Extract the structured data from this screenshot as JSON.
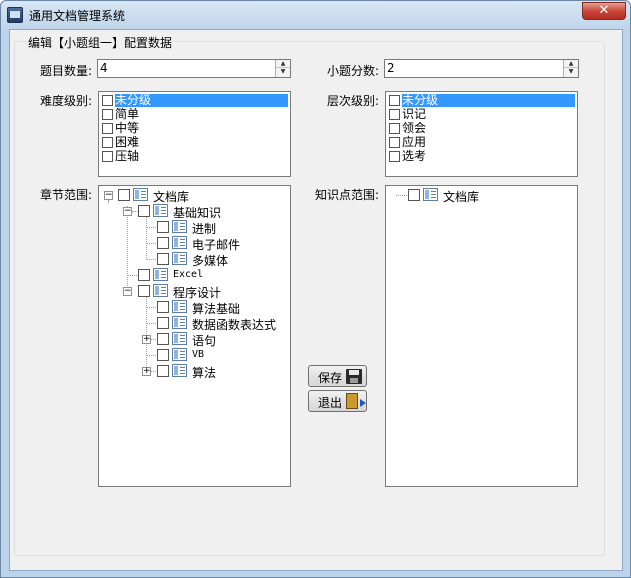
{
  "window": {
    "title": "通用文档管理系统",
    "close_glyph": "✕"
  },
  "form": {
    "group_label": "编辑【小题组一】配置数据",
    "question_count": {
      "label": "题目数量:",
      "value": "4"
    },
    "sub_score": {
      "label": "小题分数:",
      "value": "2"
    },
    "difficulty": {
      "label": "难度级别:",
      "items": [
        "未分级",
        "简单",
        "中等",
        "困难",
        "压轴"
      ],
      "selected": 0
    },
    "level": {
      "label": "层次级别:",
      "items": [
        "未分级",
        "识记",
        "领会",
        "应用",
        "选考"
      ],
      "selected": 0
    },
    "chapter_scope": {
      "label": "章节范围:",
      "nodes": [
        {
          "text": "文档库"
        },
        {
          "text": "基础知识"
        },
        {
          "text": "进制"
        },
        {
          "text": "电子邮件"
        },
        {
          "text": "多媒体"
        },
        {
          "text": "Excel"
        },
        {
          "text": "程序设计"
        },
        {
          "text": "算法基础"
        },
        {
          "text": "数据函数表达式"
        },
        {
          "text": "语句"
        },
        {
          "text": "VB"
        },
        {
          "text": "算法"
        }
      ]
    },
    "knowledge_scope": {
      "label": "知识点范围:",
      "nodes": [
        {
          "text": "文档库"
        }
      ]
    },
    "buttons": {
      "save": "保存",
      "exit": "退出"
    }
  }
}
